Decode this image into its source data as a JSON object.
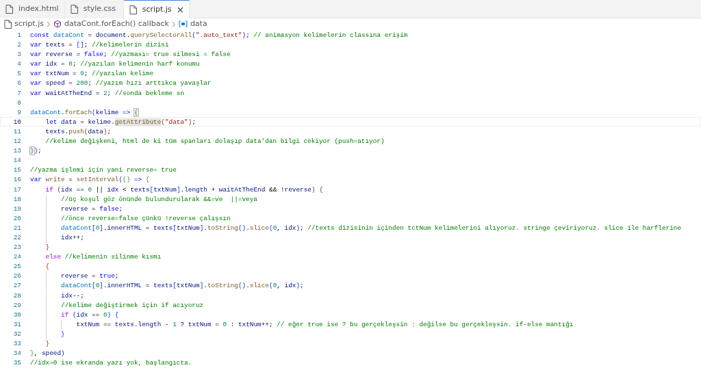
{
  "tabs": [
    {
      "label": "index.html",
      "selected": false
    },
    {
      "label": "style.css",
      "selected": false
    },
    {
      "label": "script.js",
      "selected": true
    }
  ],
  "breadcrumb": [
    {
      "text": "script.js",
      "kind": "file"
    },
    {
      "text": "dataCont.forEach() callback",
      "kind": "method"
    },
    {
      "text": "data",
      "kind": "variable"
    }
  ],
  "lines": [
    {
      "n": "1",
      "current": false,
      "tokens": [
        {
          "t": "const ",
          "kind": "kw"
        },
        {
          "t": "dataCont",
          "kind": "const"
        },
        {
          "t": " = ",
          "kind": "p"
        },
        {
          "t": "document",
          "kind": "var"
        },
        {
          "t": ".",
          "kind": "p"
        },
        {
          "t": "querySelectorAll",
          "kind": "fn"
        },
        {
          "t": "(",
          "kind": "b1"
        },
        {
          "t": "\".auto_text\"",
          "kind": "str"
        },
        {
          "t": ")",
          "kind": "b1"
        },
        {
          "t": "; ",
          "kind": "p"
        },
        {
          "t": "// animasyon kelimelerin classına erişim",
          "kind": "cm"
        }
      ]
    },
    {
      "n": "2",
      "current": false,
      "tokens": [
        {
          "t": "var ",
          "kind": "kw"
        },
        {
          "t": "texts",
          "kind": "var"
        },
        {
          "t": " = ",
          "kind": "p"
        },
        {
          "t": "[]",
          "kind": "b1"
        },
        {
          "t": "; ",
          "kind": "p"
        },
        {
          "t": "//kelimelerin dizisi",
          "kind": "cm"
        }
      ]
    },
    {
      "n": "3",
      "current": false,
      "tokens": [
        {
          "t": "var ",
          "kind": "kw"
        },
        {
          "t": "reverse",
          "kind": "var"
        },
        {
          "t": " = ",
          "kind": "p"
        },
        {
          "t": "false",
          "kind": "kw"
        },
        {
          "t": "; ",
          "kind": "p"
        },
        {
          "t": "//yazması= true silmesi = false",
          "kind": "cm"
        }
      ]
    },
    {
      "n": "4",
      "current": false,
      "tokens": [
        {
          "t": "var ",
          "kind": "kw"
        },
        {
          "t": "idx",
          "kind": "var"
        },
        {
          "t": " = ",
          "kind": "p"
        },
        {
          "t": "0",
          "kind": "num"
        },
        {
          "t": "; ",
          "kind": "p"
        },
        {
          "t": "//yazılan kelimenin harf konumu",
          "kind": "cm"
        }
      ]
    },
    {
      "n": "5",
      "current": false,
      "tokens": [
        {
          "t": "var ",
          "kind": "kw"
        },
        {
          "t": "txtNum",
          "kind": "var"
        },
        {
          "t": " = ",
          "kind": "p"
        },
        {
          "t": "0",
          "kind": "num"
        },
        {
          "t": "; ",
          "kind": "p"
        },
        {
          "t": "//yazılan kelime",
          "kind": "cm"
        }
      ]
    },
    {
      "n": "6",
      "current": false,
      "tokens": [
        {
          "t": "var ",
          "kind": "kw"
        },
        {
          "t": "speed",
          "kind": "var"
        },
        {
          "t": " = ",
          "kind": "p"
        },
        {
          "t": "200",
          "kind": "num"
        },
        {
          "t": "; ",
          "kind": "p"
        },
        {
          "t": "//yazım hızı arttıkca yavaşlar",
          "kind": "cm"
        }
      ]
    },
    {
      "n": "7",
      "current": false,
      "tokens": [
        {
          "t": "var ",
          "kind": "kw"
        },
        {
          "t": "waitAtTheEnd",
          "kind": "var"
        },
        {
          "t": " = ",
          "kind": "p"
        },
        {
          "t": "2",
          "kind": "num"
        },
        {
          "t": "; ",
          "kind": "p"
        },
        {
          "t": "//sonda bekleme sn",
          "kind": "cm"
        }
      ]
    },
    {
      "n": "8",
      "current": false
    },
    {
      "n": "9",
      "current": false,
      "tokens": [
        {
          "t": "dataCont",
          "kind": "const"
        },
        {
          "t": ".",
          "kind": "p"
        },
        {
          "t": "forEach",
          "kind": "fn"
        },
        {
          "t": "(",
          "kind": "b1"
        },
        {
          "t": "kelime ",
          "kind": "var"
        },
        {
          "t": "=> ",
          "kind": "kw"
        },
        {
          "t": "{",
          "kind": "b2m"
        }
      ],
      "children": [
        {
          "n": "10",
          "current": true,
          "tokens": [
            {
              "t": "let ",
              "kind": "kw"
            },
            {
              "t": "data",
              "kind": "var"
            },
            {
              "t": " = ",
              "kind": "p"
            },
            {
              "t": "kelime",
              "kind": "var"
            },
            {
              "t": ".",
              "kind": "p"
            },
            {
              "t": "getAttribute",
              "kind": "fnh"
            },
            {
              "t": "(",
              "kind": "b3"
            },
            {
              "t": "\"data\"",
              "kind": "str"
            },
            {
              "t": ")",
              "kind": "b3"
            },
            {
              "t": ";",
              "kind": "p"
            }
          ]
        },
        {
          "n": "11",
          "current": false,
          "tokens": [
            {
              "t": "texts",
              "kind": "var"
            },
            {
              "t": ".",
              "kind": "p"
            },
            {
              "t": "push",
              "kind": "fn"
            },
            {
              "t": "(",
              "kind": "b3"
            },
            {
              "t": "data",
              "kind": "var"
            },
            {
              "t": ")",
              "kind": "b3"
            },
            {
              "t": ";",
              "kind": "p"
            }
          ]
        },
        {
          "n": "12",
          "current": false,
          "tokens": [
            {
              "t": "//kelime değişkeni, html de ki tüm spanları dolaşıp data'dan bilgi cekiyor (push=atıyor)",
              "kind": "cm"
            }
          ]
        }
      ]
    },
    {
      "n": "13",
      "current": false,
      "tokens": [
        {
          "t": "}",
          "kind": "b2m"
        },
        {
          "t": ")",
          "kind": "b1"
        },
        {
          "t": ";",
          "kind": "p"
        }
      ]
    },
    {
      "n": "14",
      "current": false
    },
    {
      "n": "15",
      "current": false,
      "tokens": [
        {
          "t": "//yazma işlemi için yani reverse= true",
          "kind": "cm"
        }
      ]
    },
    {
      "n": "16",
      "current": false,
      "tokens": [
        {
          "t": "var ",
          "kind": "kw"
        },
        {
          "t": "write",
          "kind": "fn"
        },
        {
          "t": " = ",
          "kind": "p"
        },
        {
          "t": "setInterval",
          "kind": "fn"
        },
        {
          "t": "(",
          "kind": "b1"
        },
        {
          "t": "() ",
          "kind": "b2"
        },
        {
          "t": "=> ",
          "kind": "kw"
        },
        {
          "t": "{",
          "kind": "b2"
        }
      ],
      "children": [
        {
          "n": "17",
          "current": false,
          "tokens": [
            {
              "t": "if ",
              "kind": "ctrl"
            },
            {
              "t": "(",
              "kind": "b3"
            },
            {
              "t": "idx",
              "kind": "var"
            },
            {
              "t": " == ",
              "kind": "p"
            },
            {
              "t": "0",
              "kind": "num"
            },
            {
              "t": " || ",
              "kind": "p"
            },
            {
              "t": "idx",
              "kind": "var"
            },
            {
              "t": " < ",
              "kind": "p"
            },
            {
              "t": "texts",
              "kind": "var"
            },
            {
              "t": "[",
              "kind": "b1"
            },
            {
              "t": "txtNum",
              "kind": "var"
            },
            {
              "t": "]",
              "kind": "b1"
            },
            {
              "t": ".",
              "kind": "p"
            },
            {
              "t": "length",
              "kind": "var"
            },
            {
              "t": " + ",
              "kind": "p"
            },
            {
              "t": "waitAtTheEnd",
              "kind": "var"
            },
            {
              "t": " && !",
              "kind": "p"
            },
            {
              "t": "reverse",
              "kind": "var"
            },
            {
              "t": ") ",
              "kind": "b3"
            },
            {
              "t": "{",
              "kind": "b3"
            }
          ],
          "children": [
            {
              "n": "18",
              "current": false,
              "tokens": [
                {
                  "t": "//üç koşul göz önünde bulundurularak &&=ve  ||=veya",
                  "kind": "cm"
                }
              ]
            },
            {
              "n": "19",
              "current": false,
              "tokens": [
                {
                  "t": "reverse",
                  "kind": "var"
                },
                {
                  "t": " = ",
                  "kind": "p"
                },
                {
                  "t": "false",
                  "kind": "kw"
                },
                {
                  "t": ";",
                  "kind": "p"
                }
              ]
            },
            {
              "n": "20",
              "current": false,
              "tokens": [
                {
                  "t": "//önce reverse=false çünkü !reverse çalışsın",
                  "kind": "cm"
                }
              ]
            },
            {
              "n": "21",
              "current": false,
              "tokens": [
                {
                  "t": "dataCont",
                  "kind": "const"
                },
                {
                  "t": "[",
                  "kind": "b1"
                },
                {
                  "t": "0",
                  "kind": "num"
                },
                {
                  "t": "]",
                  "kind": "b1"
                },
                {
                  "t": ".",
                  "kind": "p"
                },
                {
                  "t": "innerHTML",
                  "kind": "var"
                },
                {
                  "t": " = ",
                  "kind": "p"
                },
                {
                  "t": "texts",
                  "kind": "var"
                },
                {
                  "t": "[",
                  "kind": "b1"
                },
                {
                  "t": "txtNum",
                  "kind": "var"
                },
                {
                  "t": "]",
                  "kind": "b1"
                },
                {
                  "t": ".",
                  "kind": "p"
                },
                {
                  "t": "toString",
                  "kind": "fn"
                },
                {
                  "t": "()",
                  "kind": "b1"
                },
                {
                  "t": ".",
                  "kind": "p"
                },
                {
                  "t": "slice",
                  "kind": "fn"
                },
                {
                  "t": "(",
                  "kind": "b1"
                },
                {
                  "t": "0",
                  "kind": "num"
                },
                {
                  "t": ", ",
                  "kind": "p"
                },
                {
                  "t": "idx",
                  "kind": "var"
                },
                {
                  "t": ")",
                  "kind": "b1"
                },
                {
                  "t": "; ",
                  "kind": "p"
                },
                {
                  "t": "//texts dizisinin içinden tctNum kelimelerini alıyoruz. stringe çeviriyoruz. slice ile harflerine",
                  "kind": "cm"
                }
              ]
            },
            {
              "n": "22",
              "current": false,
              "tokens": [
                {
                  "t": "idx",
                  "kind": "var"
                },
                {
                  "t": "++;",
                  "kind": "p"
                }
              ]
            }
          ]
        },
        {
          "n": "23",
          "current": false,
          "tokens": [
            {
              "t": "}",
              "kind": "b3"
            }
          ]
        },
        {
          "n": "24",
          "current": false,
          "tokens": [
            {
              "t": "else ",
              "kind": "ctrl"
            },
            {
              "t": "//kelimenin silinme kısmı",
              "kind": "cm"
            }
          ]
        },
        {
          "n": "25",
          "current": false,
          "tokens": [
            {
              "t": "{",
              "kind": "b3"
            }
          ],
          "children": [
            {
              "n": "26",
              "current": false,
              "tokens": [
                {
                  "t": "reverse",
                  "kind": "var"
                },
                {
                  "t": " = ",
                  "kind": "p"
                },
                {
                  "t": "true",
                  "kind": "kw"
                },
                {
                  "t": ";",
                  "kind": "p"
                }
              ]
            },
            {
              "n": "27",
              "current": false,
              "tokens": [
                {
                  "t": "dataCont",
                  "kind": "const"
                },
                {
                  "t": "[",
                  "kind": "b1"
                },
                {
                  "t": "0",
                  "kind": "num"
                },
                {
                  "t": "]",
                  "kind": "b1"
                },
                {
                  "t": ".",
                  "kind": "p"
                },
                {
                  "t": "innerHTML",
                  "kind": "var"
                },
                {
                  "t": " = ",
                  "kind": "p"
                },
                {
                  "t": "texts",
                  "kind": "var"
                },
                {
                  "t": "[",
                  "kind": "b1"
                },
                {
                  "t": "txtNum",
                  "kind": "var"
                },
                {
                  "t": "]",
                  "kind": "b1"
                },
                {
                  "t": ".",
                  "kind": "p"
                },
                {
                  "t": "toString",
                  "kind": "fn"
                },
                {
                  "t": "()",
                  "kind": "b1"
                },
                {
                  "t": ".",
                  "kind": "p"
                },
                {
                  "t": "slice",
                  "kind": "fn"
                },
                {
                  "t": "(",
                  "kind": "b1"
                },
                {
                  "t": "0",
                  "kind": "num"
                },
                {
                  "t": ", ",
                  "kind": "p"
                },
                {
                  "t": "idx",
                  "kind": "var"
                },
                {
                  "t": ")",
                  "kind": "b1"
                },
                {
                  "t": ";",
                  "kind": "p"
                }
              ]
            },
            {
              "n": "28",
              "current": false,
              "tokens": [
                {
                  "t": "idx",
                  "kind": "var"
                },
                {
                  "t": "--;",
                  "kind": "p"
                }
              ]
            },
            {
              "n": "29",
              "current": false,
              "tokens": [
                {
                  "t": "//kelime değiştirmek için if acıyoruz",
                  "kind": "cm"
                }
              ]
            },
            {
              "n": "30",
              "current": false,
              "tokens": [
                {
                  "t": "if ",
                  "kind": "ctrl"
                },
                {
                  "t": "(",
                  "kind": "b1"
                },
                {
                  "t": "idx",
                  "kind": "var"
                },
                {
                  "t": " == ",
                  "kind": "p"
                },
                {
                  "t": "0",
                  "kind": "num"
                },
                {
                  "t": ") ",
                  "kind": "b1"
                },
                {
                  "t": "{",
                  "kind": "b1"
                }
              ],
              "children": [
                {
                  "n": "31",
                  "current": false,
                  "tokens": [
                    {
                      "t": "txtNum",
                      "kind": "var"
                    },
                    {
                      "t": " == ",
                      "kind": "p"
                    },
                    {
                      "t": "texts",
                      "kind": "var"
                    },
                    {
                      "t": ".",
                      "kind": "p"
                    },
                    {
                      "t": "length",
                      "kind": "var"
                    },
                    {
                      "t": " - ",
                      "kind": "p"
                    },
                    {
                      "t": "1",
                      "kind": "num"
                    },
                    {
                      "t": " ? ",
                      "kind": "p"
                    },
                    {
                      "t": "txtNum",
                      "kind": "var"
                    },
                    {
                      "t": " = ",
                      "kind": "p"
                    },
                    {
                      "t": "0",
                      "kind": "num"
                    },
                    {
                      "t": " : ",
                      "kind": "p"
                    },
                    {
                      "t": "txtNum",
                      "kind": "var"
                    },
                    {
                      "t": "++; ",
                      "kind": "p"
                    },
                    {
                      "t": "// eğer true ise ? bu gerçekleşsin : değilse bu gerçekleşsin. if-else mantığı",
                      "kind": "cm"
                    }
                  ]
                }
              ]
            },
            {
              "n": "32",
              "current": false,
              "tokens": [
                {
                  "t": "}",
                  "kind": "b1"
                }
              ]
            }
          ]
        },
        {
          "n": "33",
          "current": false,
          "tokens": [
            {
              "t": "}",
              "kind": "b3"
            }
          ]
        }
      ]
    },
    {
      "n": "34",
      "current": false,
      "tokens": [
        {
          "t": "}",
          "kind": "b2"
        },
        {
          "t": ", ",
          "kind": "p"
        },
        {
          "t": "speed",
          "kind": "var"
        },
        {
          "t": ")",
          "kind": "b1"
        }
      ]
    },
    {
      "n": "35",
      "current": false,
      "tokens": [
        {
          "t": "//idx=0 ise ekranda yazı yok, başlangıcta.",
          "kind": "cm"
        }
      ]
    }
  ]
}
